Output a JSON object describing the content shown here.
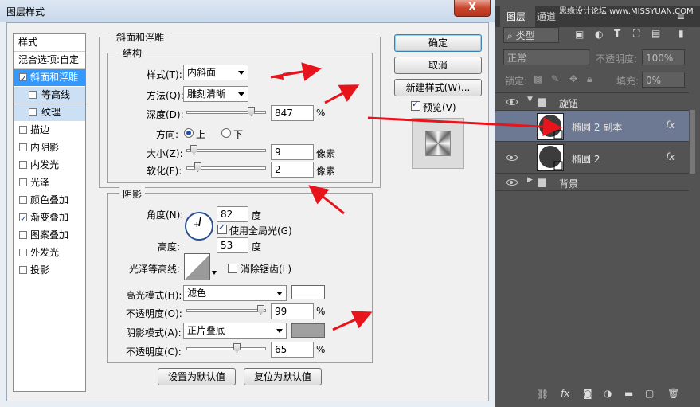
{
  "dialog": {
    "title": "图层样式",
    "close_glyph": "X",
    "styles_header": "样式",
    "blend_options": "混合选项:自定",
    "style_items": [
      {
        "label": "斜面和浮雕",
        "checked": true,
        "selected": true,
        "sub": false
      },
      {
        "label": "等高线",
        "checked": false,
        "selected": false,
        "sub": true
      },
      {
        "label": "纹理",
        "checked": false,
        "selected": false,
        "sub": true
      },
      {
        "label": "描边",
        "checked": false,
        "selected": false,
        "sub": false
      },
      {
        "label": "内阴影",
        "checked": false,
        "selected": false,
        "sub": false
      },
      {
        "label": "内发光",
        "checked": false,
        "selected": false,
        "sub": false
      },
      {
        "label": "光泽",
        "checked": false,
        "selected": false,
        "sub": false
      },
      {
        "label": "颜色叠加",
        "checked": false,
        "selected": false,
        "sub": false
      },
      {
        "label": "渐变叠加",
        "checked": true,
        "selected": false,
        "sub": false
      },
      {
        "label": "图案叠加",
        "checked": false,
        "selected": false,
        "sub": false
      },
      {
        "label": "外发光",
        "checked": false,
        "selected": false,
        "sub": false
      },
      {
        "label": "投影",
        "checked": false,
        "selected": false,
        "sub": false
      }
    ],
    "bevel": {
      "group_title": "斜面和浮雕",
      "structure_title": "结构",
      "style_label": "样式(T):",
      "style_value": "内斜面",
      "technique_label": "方法(Q):",
      "technique_value": "雕刻清晰",
      "depth_label": "深度(D):",
      "depth_value": "847",
      "depth_level": 0.85,
      "depth_unit": "%",
      "direction_label": "方向:",
      "dir_up": "上",
      "dir_down": "下",
      "size_label": "大小(Z):",
      "size_value": "9",
      "size_level": 0.04,
      "size_unit": "像素",
      "soften_label": "软化(F):",
      "soften_value": "2",
      "soften_level": 0.1,
      "soften_unit": "像素"
    },
    "shading": {
      "group_title": "阴影",
      "angle_label": "角度(N):",
      "angle_value": "82",
      "angle_unit": "度",
      "global_light": "使用全局光(G)",
      "altitude_label": "高度:",
      "altitude_value": "53",
      "altitude_unit": "度",
      "gloss_label": "光泽等高线:",
      "antialias": "消除锯齿(L)",
      "highlight_label": "高光模式(H):",
      "highlight_mode": "滤色",
      "highlight_color": "#ffffff",
      "hl_opacity_label": "不透明度(O):",
      "hl_opacity_value": "99",
      "hl_opacity_level": 0.99,
      "hl_opacity_unit": "%",
      "shadow_label": "阴影模式(A):",
      "shadow_mode": "正片叠底",
      "shadow_color": "#a0a0a0",
      "sh_opacity_label": "不透明度(C):",
      "sh_opacity_value": "65",
      "sh_opacity_level": 0.65,
      "sh_opacity_unit": "%"
    },
    "set_default": "设置为默认值",
    "reset_default": "复位为默认值",
    "ok": "确定",
    "cancel": "取消",
    "new_style": "新建样式(W)...",
    "preview": "预览(V)"
  },
  "layers": {
    "tab_layers": "图层",
    "tab_channels": "通道",
    "watermark": "思缘设计论坛 www.MISSYUAN.COM",
    "filter_kind": "类型",
    "blend_mode": "正常",
    "opacity_label": "不透明度:",
    "opacity_value": "100%",
    "lock_label": "锁定:",
    "fill_label": "填充:",
    "fill_value": "0%",
    "rows": [
      {
        "name": "旋钮",
        "kind": "group",
        "expanded": true
      },
      {
        "name": "椭圆 2 副本",
        "kind": "layer",
        "fx": "fx",
        "selected": true
      },
      {
        "name": "椭圆 2",
        "kind": "layer",
        "fx": "fx",
        "selected": false
      },
      {
        "name": "背景",
        "kind": "group",
        "expanded": false
      }
    ],
    "footer_glyph": "fx"
  },
  "colors": {
    "annotation_arrow": "#e8141c",
    "selection": "#3399ff",
    "panel_bg": "#535353"
  }
}
